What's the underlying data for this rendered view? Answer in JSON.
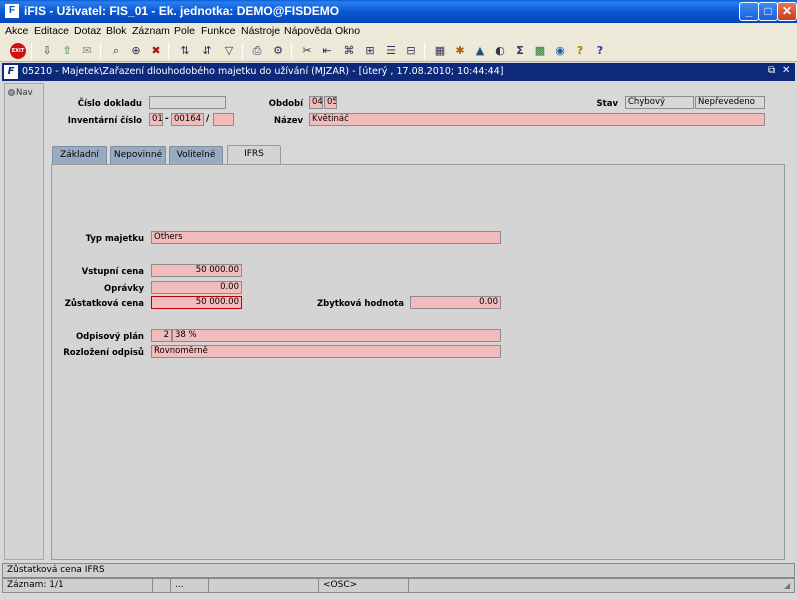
{
  "window": {
    "title": "iFIS - Uživatel: FIS_01 - Ek. jednotka: DEMO@FISDEMO",
    "app_icon": "F",
    "minimize": "_",
    "maximize": "□",
    "close": "✕"
  },
  "menu": [
    "Akce",
    "Editace",
    "Dotaz",
    "Blok",
    "Záznam",
    "Pole",
    "Funkce",
    "Nástroje",
    "Nápověda",
    "Okno"
  ],
  "toolbar": {
    "exit_label": "EXIT",
    "glyphs": [
      "⇩",
      "⇧",
      "✉",
      "⌕",
      "⊕",
      "✖",
      "⇅",
      "⇵",
      "▽",
      "⎙",
      "⚙",
      "✂",
      "⇤",
      "⌘",
      "⊞",
      "☰",
      "⊟",
      "▦",
      "✱",
      "▲",
      "◐",
      "Σ",
      "▩",
      "◉",
      "?",
      "?"
    ]
  },
  "form": {
    "window_title": "05210 - Majetek\\Zařazení dlouhodobého majetku do užívání (MJZAR) - [úterý , 17.08.2010; 10:44:44]",
    "restore": "⧉",
    "close": "✕",
    "nav_label": "Nav",
    "header": {
      "cislo_dokladu_label": "Číslo dokladu",
      "cislo_dokladu_value": "",
      "obdobi_label": "Období",
      "obdobi_value_1": "04",
      "obdobi_value_2": "05",
      "stav_label": "Stav",
      "stav_value_1": "Chybový",
      "stav_value_2": "Nepřevedeno",
      "inventarni_cislo_label": "Inventární číslo",
      "inv_part_1": "01",
      "inv_dash": "-",
      "inv_part_2": "00164",
      "inv_slash": "/",
      "inv_part_3": "",
      "nazev_label": "Název",
      "nazev_value": "Květináč"
    },
    "tabs": [
      "Základní",
      "Nepovinné",
      "Volitelné",
      "IFRS"
    ],
    "ifrs": {
      "typ_majetku_label": "Typ majetku",
      "typ_majetku_value": "Others",
      "vstupni_cena_label": "Vstupní cena",
      "vstupni_cena_value": "50 000.00",
      "opravky_label": "Oprávky",
      "opravky_value": "0.00",
      "zustatkova_cena_label": "Zůstatková cena",
      "zustatkova_cena_value": "50 000.00",
      "zbytkova_hodnota_label": "Zbytková hodnota",
      "zbytkova_hodnota_value": "0.00",
      "odpisovy_plan_label": "Odpisový plán",
      "odpisovy_plan_value_1": "2",
      "odpisovy_plan_value_2": "38 %",
      "rozlozeni_odpisu_label": "Rozložení odpisů",
      "rozlozeni_odpisu_value": "Rovnoměrně"
    }
  },
  "status": {
    "hint": "Zůstatková cena IFRS",
    "record": "Záznam: 1/1",
    "ellipsis": "...",
    "osc": "<OSC>"
  }
}
